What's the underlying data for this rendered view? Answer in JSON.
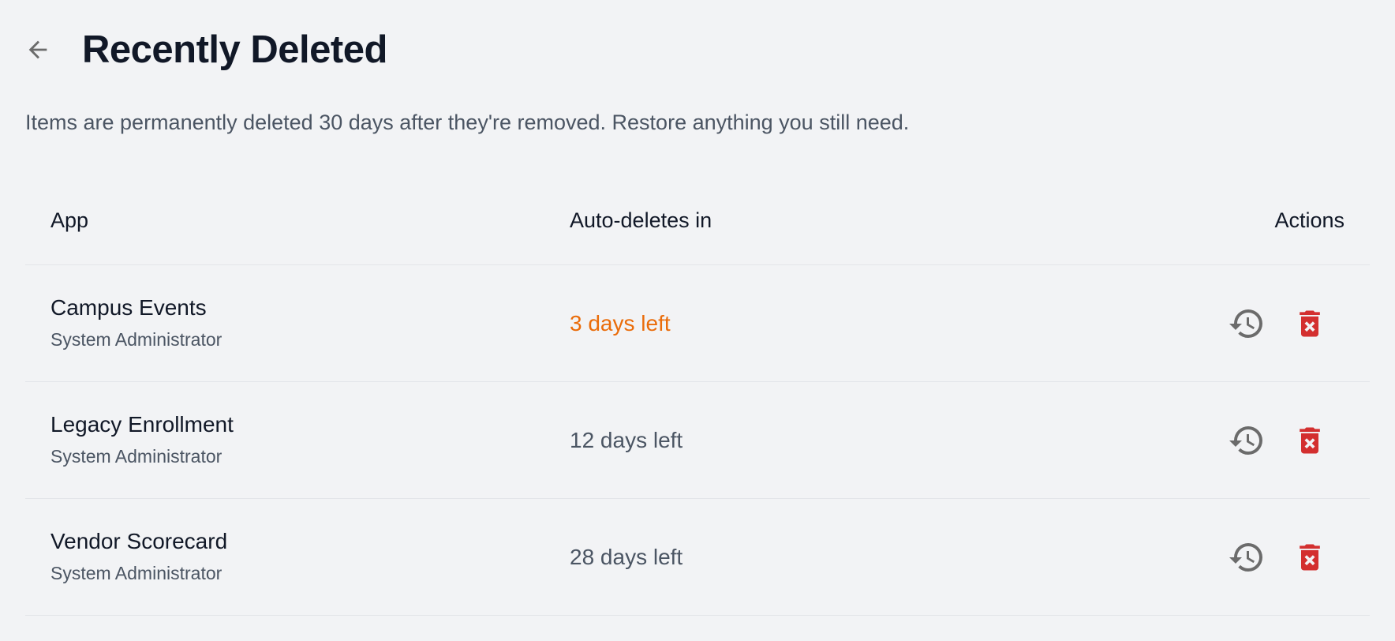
{
  "header": {
    "title": "Recently Deleted",
    "back_icon": "arrow-left-icon"
  },
  "description": "Items are permanently deleted 30 days after they're removed. Restore anything you still need.",
  "table": {
    "columns": [
      "App",
      "Auto-deletes in",
      "Actions"
    ],
    "rows": [
      {
        "name": "Campus Events",
        "owner": "System Administrator",
        "auto_delete": "3 days left",
        "urgent": true
      },
      {
        "name": "Legacy Enrollment",
        "owner": "System Administrator",
        "auto_delete": "12 days left",
        "urgent": false
      },
      {
        "name": "Vendor Scorecard",
        "owner": "System Administrator",
        "auto_delete": "28 days left",
        "urgent": false
      }
    ]
  },
  "icons": {
    "restore": "restore-history-icon",
    "delete": "delete-forever-icon"
  },
  "colors": {
    "urgent": "#ea6c0a",
    "delete": "#d32f2f",
    "restore": "#6b6b6b"
  }
}
